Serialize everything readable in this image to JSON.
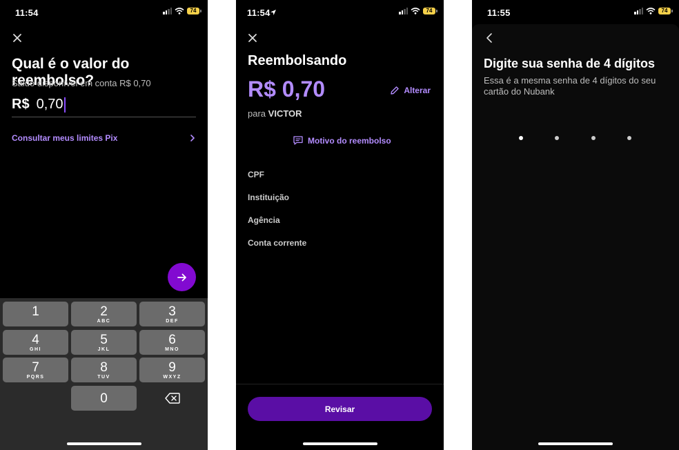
{
  "screen1": {
    "time": "11:54",
    "battery": "74",
    "title": "Qual é o valor do reembolso?",
    "saldo": "Saldo disponível em conta R$ 0,70",
    "currency": "R$",
    "amount_value": "0,70",
    "limits_link": "Consultar meus limites Pix",
    "keys": [
      {
        "d": "1",
        "l": ""
      },
      {
        "d": "2",
        "l": "ABC"
      },
      {
        "d": "3",
        "l": "DEF"
      },
      {
        "d": "4",
        "l": "GHI"
      },
      {
        "d": "5",
        "l": "JKL"
      },
      {
        "d": "6",
        "l": "MNO"
      },
      {
        "d": "7",
        "l": "PQRS"
      },
      {
        "d": "8",
        "l": "TUV"
      },
      {
        "d": "9",
        "l": "WXYZ"
      },
      {
        "d": "0",
        "l": ""
      }
    ]
  },
  "screen2": {
    "time": "11:54",
    "battery": "74",
    "title": "Reembolsando",
    "amount": "R$ 0,70",
    "edit_label": "Alterar",
    "para_label": "para",
    "recipient": "VICTOR",
    "reason_link": "Motivo do reembolso",
    "fields": [
      "CPF",
      "Instituição",
      "Agência",
      "Conta corrente"
    ],
    "review_button": "Revisar"
  },
  "screen3": {
    "time": "11:55",
    "battery": "74",
    "title": "Digite sua senha de 4 dígitos",
    "subtitle": "Essa é a mesma senha de 4 dígitos do seu cartão do Nubank",
    "pin_length": 4
  },
  "colors": {
    "accent": "#820ad1",
    "accent_text": "#b38cff",
    "button": "#5a0ea5",
    "battery": "#f5d04a",
    "background": "#000000"
  },
  "icons": [
    "close-icon",
    "chevron-right-icon",
    "arrow-right-icon",
    "backspace-icon",
    "pencil-icon",
    "message-icon",
    "chevron-left-icon",
    "signal-icon",
    "wifi-icon",
    "battery-icon",
    "location-arrow-icon"
  ]
}
